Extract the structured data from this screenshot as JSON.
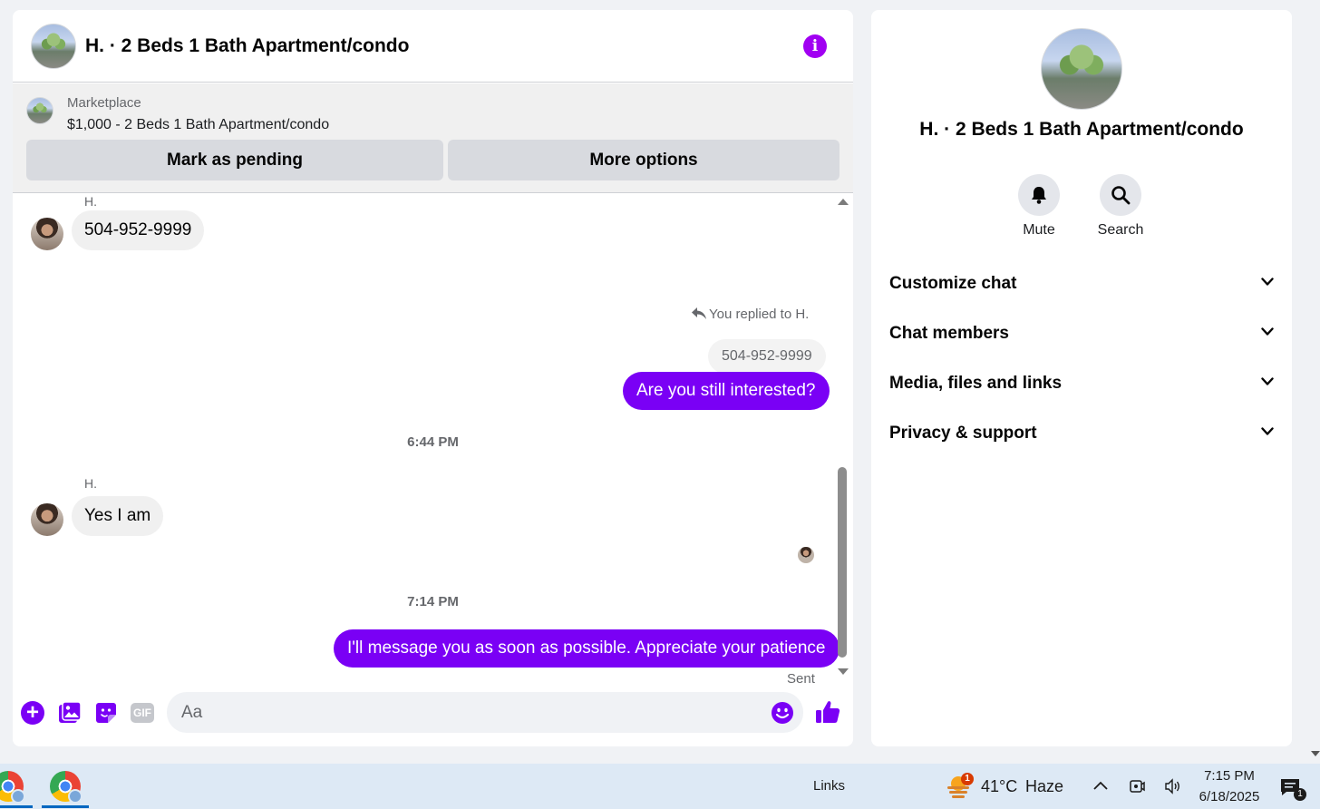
{
  "colors": {
    "accent": "#7a00f5",
    "info_icon": "#a100f2",
    "bubble_in": "#f0f0f0",
    "taskbar": "#dde9f5"
  },
  "chat": {
    "header": {
      "title": "H. · 2 Beds 1 Bath Apartment/condo",
      "avatar_icon": "listing-photo",
      "info_icon": "info-icon"
    },
    "marketplace": {
      "label": "Marketplace",
      "listing": "$1,000 - 2 Beds 1 Bath Apartment/condo",
      "mark_pending_label": "Mark as pending",
      "more_options_label": "More options"
    },
    "messages": {
      "sender_1": "H.",
      "msg_1": "504-952-9999",
      "reply_note": "You replied to H.",
      "reply_quote": "504-952-9999",
      "msg_2": "Are you still interested?",
      "time_1": "6:44 PM",
      "sender_2": "H.",
      "msg_3": "Yes I am",
      "time_2": "7:14 PM",
      "msg_4": "I'll message you as soon as possible. Appreciate your patience",
      "status": "Sent"
    },
    "composer": {
      "placeholder": "Aa",
      "gif_label": "GIF",
      "plus_label": "+"
    }
  },
  "info": {
    "title": "H. · 2 Beds 1 Bath Apartment/condo",
    "actions": {
      "mute": "Mute",
      "search": "Search"
    },
    "sections": [
      "Customize chat",
      "Chat members",
      "Media, files and links",
      "Privacy & support"
    ]
  },
  "taskbar": {
    "links": "Links",
    "weather_badge": "1",
    "temperature": "41°C",
    "condition": "Haze",
    "time": "7:15 PM",
    "date": "6/18/2025",
    "notification_count": "1"
  }
}
